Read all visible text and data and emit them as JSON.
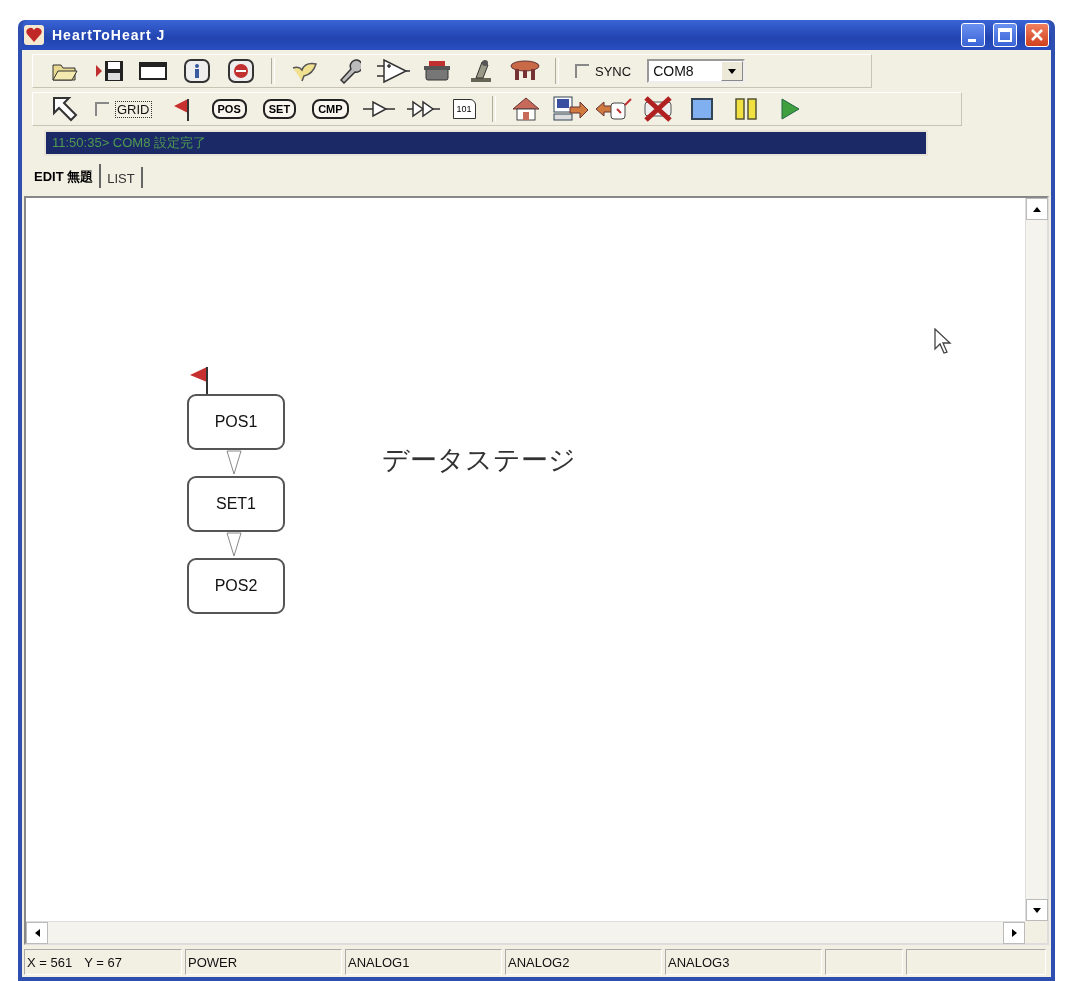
{
  "window": {
    "title": "HeartToHeart J"
  },
  "toolbar_1": {
    "sync": {
      "label": "SYNC",
      "checked": false
    },
    "port": {
      "value": "COM8"
    }
  },
  "toolbar_2": {
    "grid": {
      "label": "GRID",
      "checked": false
    },
    "tags": [
      {
        "label": "POS"
      },
      {
        "label": "SET"
      },
      {
        "label": "CMP"
      }
    ],
    "data_tag": {
      "label": "101"
    }
  },
  "message": "11:50:35> COM8 設定完了",
  "tabs": [
    {
      "label": "EDIT 無題",
      "selected": true
    },
    {
      "label": "LIST",
      "selected": false
    }
  ],
  "canvas": {
    "nodes": [
      {
        "label": "POS1",
        "flag": true
      },
      {
        "label": "SET1",
        "flag": false
      },
      {
        "label": "POS2",
        "flag": false
      }
    ],
    "caption": "データステージ"
  },
  "status_bar": {
    "coords": [
      "X = 561",
      "Y = 67"
    ],
    "panels": [
      {
        "label": "POWER"
      },
      {
        "label": "ANALOG1"
      },
      {
        "label": "ANALOG2"
      },
      {
        "label": "ANALOG3"
      }
    ]
  }
}
